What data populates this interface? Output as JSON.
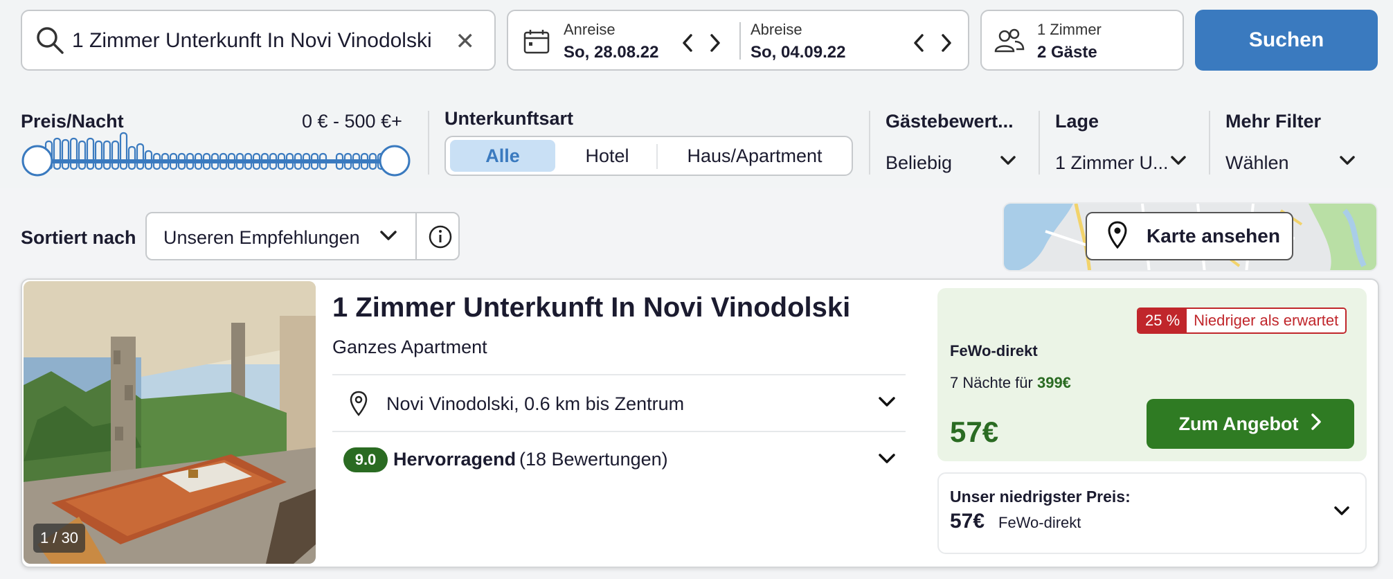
{
  "search": {
    "query": "1 Zimmer Unterkunft In Novi Vinodolski",
    "checkin_label": "Anreise",
    "checkin_value": "So, 28.08.22",
    "checkout_label": "Abreise",
    "checkout_value": "So, 04.09.22",
    "rooms": "1 Zimmer",
    "guests": "2 Gäste",
    "submit_label": "Suchen"
  },
  "filters": {
    "price_label": "Preis/Nacht",
    "price_range": "0 € - 500 €+",
    "price_min_fraction": 0.0,
    "price_max_fraction": 1.0,
    "type_label": "Unterkunftsart",
    "type_options": [
      "Alle",
      "Hotel",
      "Haus/Apartment"
    ],
    "type_selected": "Alle",
    "rating_label": "Gästebewert...",
    "rating_value": "Beliebig",
    "location_label": "Lage",
    "location_value": "1 Zimmer U...",
    "more_label": "Mehr Filter",
    "more_value": "Wählen"
  },
  "sort": {
    "label": "Sortiert nach",
    "value": "Unseren Empfehlungen"
  },
  "map": {
    "button_label": "Karte ansehen"
  },
  "result": {
    "title": "1 Zimmer Unterkunft In Novi Vinodolski",
    "type": "Ganzes Apartment",
    "location": "Novi Vinodolski, 0.6 km bis Zentrum",
    "rating_score": "9.0",
    "rating_word": "Hervorragend",
    "rating_count": "(18 Bewertungen)",
    "photo_counter": "1 / 30",
    "deal": {
      "discount_pct": "25 %",
      "discount_text": "Niedriger als erwartet",
      "provider": "FeWo-direkt",
      "nights_text": "7 Nächte für",
      "nights_total": "399€",
      "price": "57€",
      "button_label": "Zum Angebot"
    },
    "lowest": {
      "title": "Unser niedrigster Preis:",
      "price": "57€",
      "provider": "FeWo-direkt"
    }
  },
  "colors": {
    "primary_blue": "#3a7abf",
    "deal_green": "#2f7b23",
    "price_green": "#2a6b22",
    "discount_red": "#c0262b"
  }
}
